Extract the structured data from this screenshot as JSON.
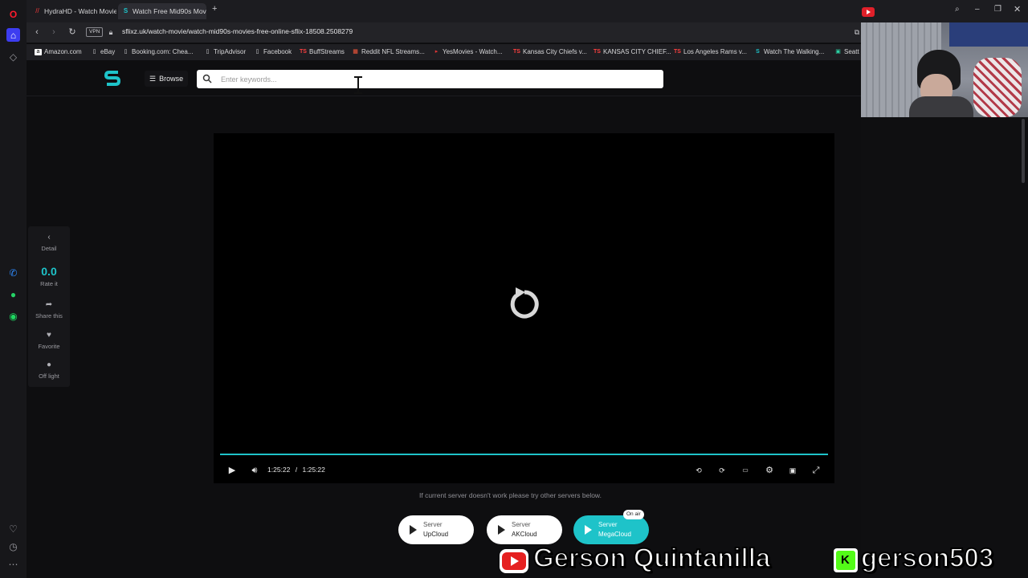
{
  "browser": {
    "tabs": [
      {
        "label": "HydraHD - Watch Movie",
        "icon": "hydrahd-favicon",
        "active": false
      },
      {
        "label": "Watch Free Mid90s Movie",
        "icon": "sflix-favicon",
        "active": true
      }
    ],
    "new_tab_label": "+",
    "url": "sflixz.uk/watch-movie/watch-mid90s-movies-free-online-sflix-18508.2508279",
    "vpn_label": "VPN",
    "bookmarks": [
      {
        "label": "Amazon.com",
        "icon": "amazon-icon"
      },
      {
        "label": "eBay",
        "icon": "file-icon"
      },
      {
        "label": "Booking.com: Chea...",
        "icon": "file-icon"
      },
      {
        "label": "TripAdvisor",
        "icon": "file-icon"
      },
      {
        "label": "Facebook",
        "icon": "file-icon"
      },
      {
        "label": "BuffStreams",
        "icon": "ts-icon"
      },
      {
        "label": "Reddit NFL Streams...",
        "icon": "reddit-icon"
      },
      {
        "label": "YesMovies - Watch...",
        "icon": "yesmovies-icon"
      },
      {
        "label": "Kansas City Chiefs v...",
        "icon": "ts-icon"
      },
      {
        "label": "KANSAS CITY CHIEF...",
        "icon": "ts-icon"
      },
      {
        "label": "Los Angeles Rams v...",
        "icon": "ts-icon"
      },
      {
        "label": "Watch The Walking...",
        "icon": "sflix-icon"
      },
      {
        "label": "Seatt",
        "icon": "green-icon"
      }
    ]
  },
  "site": {
    "browse_label": "Browse",
    "search_placeholder": "Enter keywords..."
  },
  "actions": [
    {
      "label": "Detail",
      "icon": "chevron-left-icon"
    },
    {
      "label": "Rate it",
      "value": "0.0"
    },
    {
      "label": "Share this",
      "icon": "share-icon"
    },
    {
      "label": "Favorite",
      "icon": "heart-icon"
    },
    {
      "label": "Off light",
      "icon": "bulb-icon"
    }
  ],
  "player": {
    "time_current": "1:25:22",
    "time_separator": "/",
    "time_total": "1:25:22",
    "progress": 1.0,
    "accent": "#1ec3c9"
  },
  "servers": {
    "message": "If current server doesn't work please try other servers below.",
    "list": [
      {
        "line1": "Server",
        "line2": "UpCloud",
        "active": false
      },
      {
        "line1": "Server",
        "line2": "AKCloud",
        "active": false
      },
      {
        "line1": "Server",
        "line2": "MegaCloud",
        "active": true,
        "badge": "On air"
      }
    ]
  },
  "overlays": {
    "youtube_name": "Gerson Quintanilla",
    "kick_name": "gerson503"
  }
}
